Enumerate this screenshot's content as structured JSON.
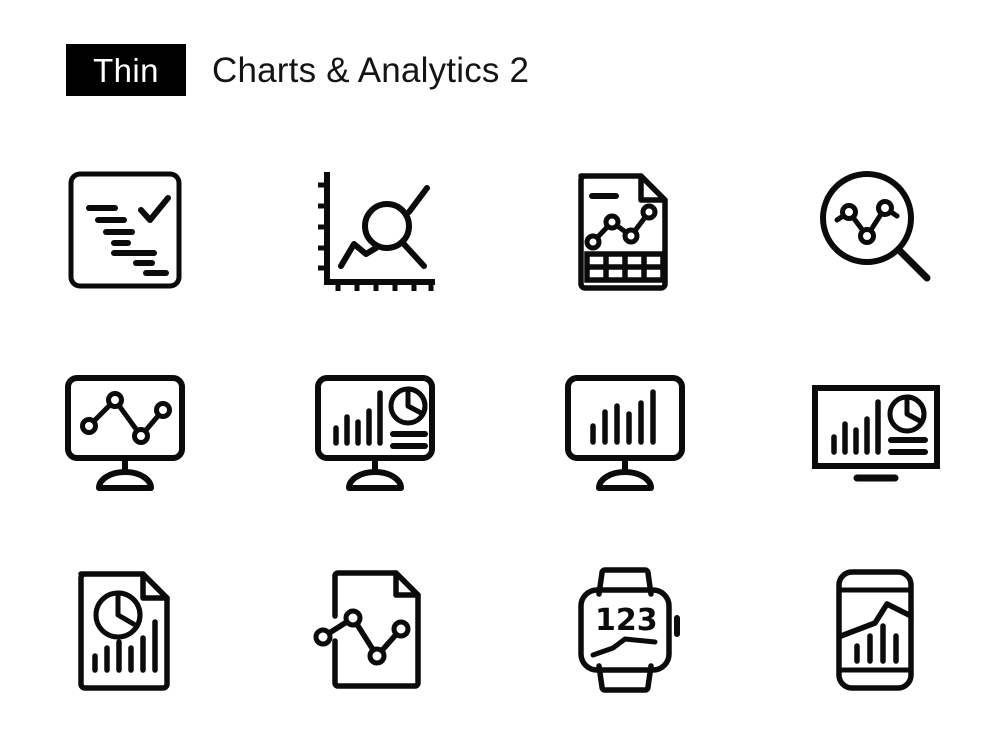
{
  "header": {
    "style_badge": "Thin",
    "title": "Charts & Analytics 2"
  },
  "colors": {
    "stroke": "#0b0b0b",
    "background": "#ffffff",
    "badge_background": "#000000",
    "badge_text": "#ffffff"
  },
  "grid": {
    "columns": 4,
    "rows": 3,
    "total_icons": 12
  },
  "icons": [
    {
      "index": 1,
      "name": "checklist-report-icon",
      "label": "Checklist Report",
      "description": "Rounded square frame containing a check mark and a descending staircase of seven text lines"
    },
    {
      "index": 2,
      "name": "axis-chart-search-icon",
      "label": "Analyze Graph Axes",
      "description": "X and Y axes with tick marks, a zigzag line graph and a magnifying glass"
    },
    {
      "index": 3,
      "name": "report-document-table-icon",
      "label": "Report Document with Table",
      "description": "Document with folded corner, line graph with four nodes and a four by two data table"
    },
    {
      "index": 4,
      "name": "magnifier-line-chart-icon",
      "label": "Data Analysis Search",
      "description": "Magnifying glass containing a three node line graph"
    },
    {
      "index": 5,
      "name": "monitor-line-chart-icon",
      "label": "Monitor Line Chart",
      "description": "Desktop monitor on a pedestal stand showing a four node line graph"
    },
    {
      "index": 6,
      "name": "monitor-dashboard-icon",
      "label": "Monitor Dashboard",
      "description": "Desktop monitor showing bar chart, pie chart and two text lines"
    },
    {
      "index": 7,
      "name": "monitor-bar-chart-icon",
      "label": "Monitor Bar Chart",
      "description": "Desktop monitor on a pedestal stand showing a six bar ascending chart"
    },
    {
      "index": 8,
      "name": "widescreen-dashboard-icon",
      "label": "Widescreen Dashboard",
      "description": "Flat widescreen display with bar chart, pie chart, text lines and a base bar"
    },
    {
      "index": 9,
      "name": "document-pie-bar-icon",
      "label": "Analytics Document",
      "description": "Document with folded corner containing a pie chart and six bar chart"
    },
    {
      "index": 10,
      "name": "document-line-chart-icon",
      "label": "Line Chart Document",
      "description": "Document with folded corner and an overlapping four node line graph"
    },
    {
      "index": 11,
      "name": "smartwatch-chart-icon",
      "label": "Smartwatch Statistics",
      "description": "Smart watch with bands showing the number 123 and a line graph"
    },
    {
      "index": 12,
      "name": "smartphone-chart-icon",
      "label": "Mobile Analytics",
      "description": "Smartphone displaying an area line graph above four ascending bars"
    }
  ],
  "watch": {
    "display_value": "123"
  }
}
